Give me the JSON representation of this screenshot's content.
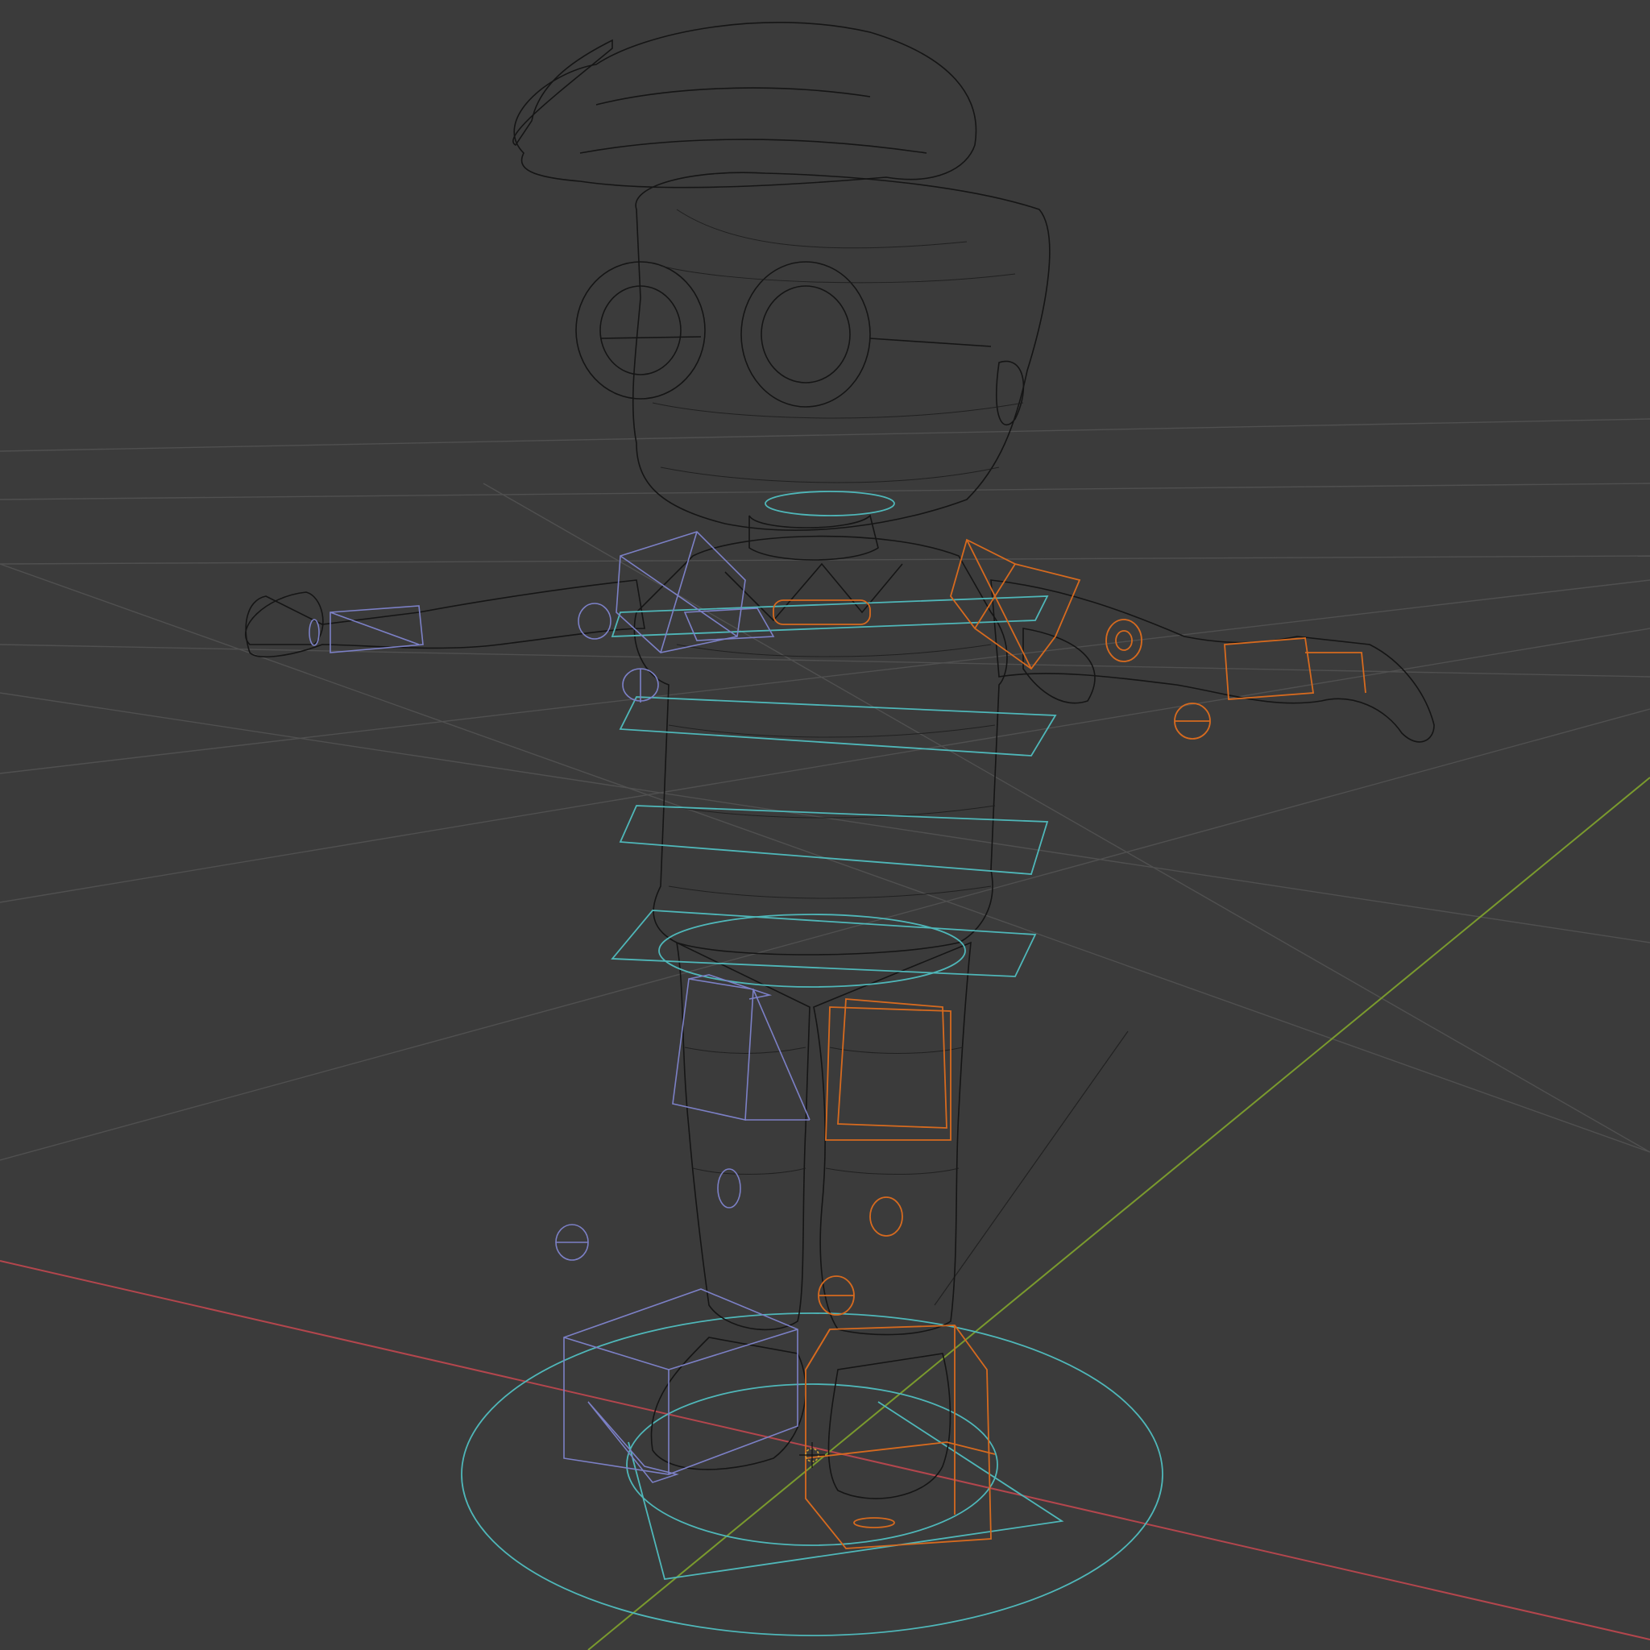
{
  "app": {
    "editor": "3D Viewport",
    "shading_mode": "wireframe"
  },
  "colors": {
    "background": "#3b3b3b",
    "grid": "#505050",
    "x_axis": "#b3464d",
    "y_axis": "#7a9a2e",
    "mesh_wire": "#151515",
    "control_center": "#4fb7b9",
    "control_left": "#7c80c6",
    "control_right": "#d66a1f"
  },
  "scene": {
    "object": "character",
    "icons": [
      "3d-cursor-icon"
    ]
  }
}
